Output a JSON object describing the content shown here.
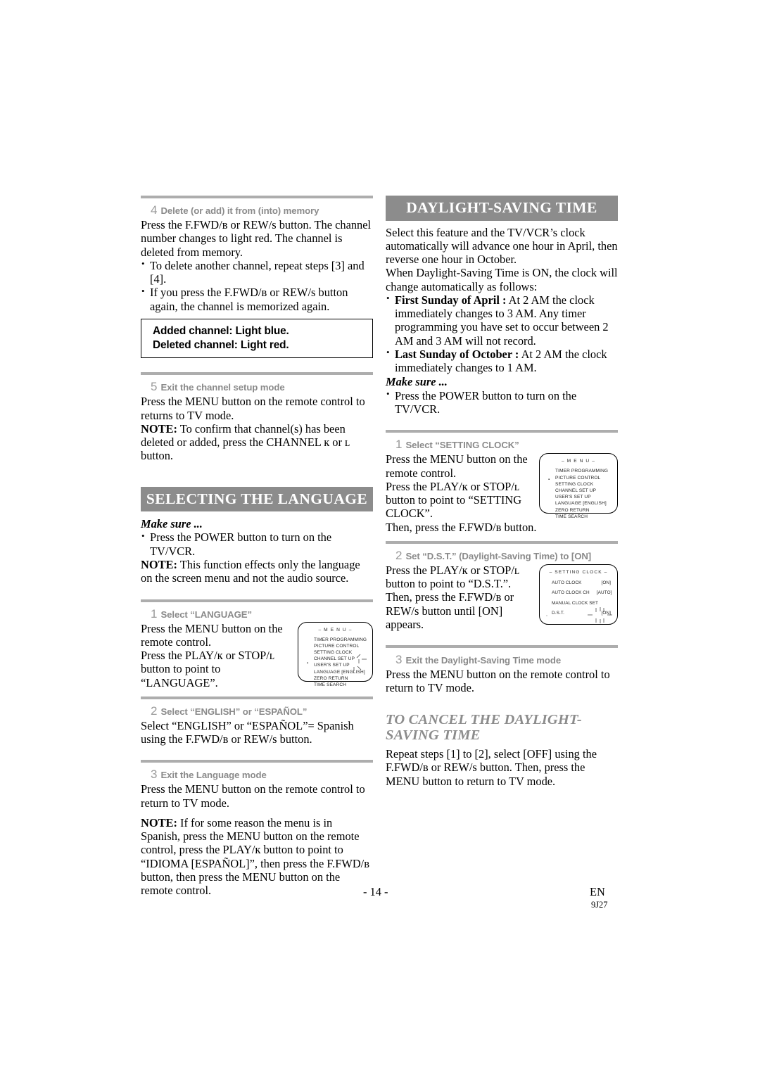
{
  "page": {
    "folio": "- 14 -",
    "language_code": "EN",
    "document_code": "9J27"
  },
  "left_column": {
    "step4": {
      "number": "4",
      "label": "Delete (or add) it from (into) memory",
      "paragraph": "Press the F.FWD/в  or REW/ѕ  button. The channel number changes to light red. The channel is deleted from memory.",
      "bullets": [
        "To delete another channel, repeat steps [3] and [4].",
        "If you press the F.FWD/в  or REW/ѕ  button again, the channel is memorized again."
      ],
      "callout": {
        "line1": "Added channel: Light blue.",
        "line2": "Deleted channel: Light red."
      }
    },
    "step5": {
      "number": "5",
      "label": "Exit the channel setup mode",
      "paragraph": "Press the MENU button on the remote control to returns to TV mode.",
      "note_label": "NOTE:",
      "note_text": " To confirm that channel(s) has been deleted or added, press the CHANNEL к  or ʟ  button."
    },
    "language_section": {
      "banner": "SELECTING THE LANGUAGE",
      "make_sure": "Make sure ...",
      "make_sure_bullets": [
        "Press the POWER button to turn on the TV/VCR."
      ],
      "note_label": "NOTE:",
      "note_text": " This function effects only the language on the screen menu and not the audio source.",
      "step1": {
        "number": "1",
        "label": "Select “LANGUAGE”",
        "paragraph1": "Press the MENU button on the remote control.",
        "paragraph2": "Press the PLAY/к  or STOP/ʟ  button to point to “LANGUAGE”."
      },
      "step2": {
        "number": "2",
        "label": "Select “ENGLISH” or “ESPAÑOL”",
        "paragraph": "Select “ENGLISH” or “ESPAÑOL”= Spanish using the F.FWD/в  or REW/ѕ  button."
      },
      "step3": {
        "number": "3",
        "label": "Exit the Language mode",
        "paragraph": "Press the MENU button on the remote control to return to TV mode.",
        "note_label": "NOTE:",
        "note_text": " If for some reason the menu is in Spanish, press the MENU button on the remote control, press the PLAY/к  button to point to “IDIOMA [ESPAÑOL]”, then press the F.FWD/в  button, then press the MENU button on the remote control."
      }
    },
    "menu_figure": {
      "title": "– M E N U –",
      "items": [
        "TIMER PROGRAMMING",
        "PICTURE CONTROL",
        "SETTING CLOCK",
        "CHANNEL SET UP",
        "USER'S SET UP",
        "LANGUAGE  [ENGLISH]",
        "ZERO RETURN",
        "TIME SEARCH"
      ],
      "cursor_item_index": 5
    }
  },
  "right_column": {
    "banner": "DAYLIGHT-SAVING TIME",
    "intro1": "Select this feature and the TV/VCR’s clock automatically will advance one hour in April, then reverse one hour in October.",
    "intro2": "When Daylight-Saving Time is ON, the clock will change automatically as follows:",
    "bullets": [
      {
        "bold": "First Sunday of April :",
        "text": " At 2 AM the clock immediately changes to 3 AM. Any timer programming you have set to occur between 2 AM and 3 AM will not record."
      },
      {
        "bold": "Last Sunday of October :",
        "text": " At 2 AM the clock immediately changes to 1 AM."
      }
    ],
    "make_sure": "Make sure ...",
    "make_sure_bullets": [
      "Press the POWER button to turn on the TV/VCR."
    ],
    "step1": {
      "number": "1",
      "label": "Select “SETTING CLOCK”",
      "paragraph1": "Press the MENU button on the remote control.",
      "paragraph2": "Press the PLAY/к  or STOP/ʟ  button to point to “SETTING CLOCK”.",
      "paragraph3": "Then, press the F.FWD/в  button."
    },
    "step2": {
      "number": "2",
      "label": "Set “D.S.T.” (Daylight-Saving Time) to [ON]",
      "paragraph1": "Press the PLAY/к  or STOP/ʟ  button to point to “D.S.T.”.",
      "paragraph2": "Then, press the F.FWD/в  or REW/ѕ  button until [ON] appears."
    },
    "step3": {
      "number": "3",
      "label": "Exit the Daylight-Saving Time mode",
      "paragraph": "Press the MENU button on the remote control to return to TV mode."
    },
    "cancel_section": {
      "heading": "TO CANCEL THE DAYLIGHT-SAVING TIME",
      "paragraph": "Repeat steps [1] to [2], select [OFF] using the F.FWD/в  or REW/ѕ  button. Then, press the MENU button to return to TV mode."
    },
    "menu_figure": {
      "title": "– M E N U –",
      "items": [
        "TIMER PROGRAMMING",
        "PICTURE CONTROL",
        "SETTING CLOCK",
        "CHANNEL SET UP",
        "USER'S SET UP",
        "LANGUAGE  [ENGLISH]",
        "ZERO RETURN",
        "TIME SEARCH"
      ],
      "cursor_item_index": 2
    },
    "clock_figure": {
      "title": "– SETTING CLOCK –",
      "rows": [
        {
          "name": "AUTO CLOCK",
          "value": "[ON]"
        },
        {
          "name": "AUTO CLOCK CH",
          "value": "[AUTO]"
        },
        {
          "name": "MANUAL CLOCK SET",
          "value": ""
        },
        {
          "name": "D.S.T.",
          "value": "[ON]"
        }
      ],
      "cursor_row_index": 3
    }
  }
}
